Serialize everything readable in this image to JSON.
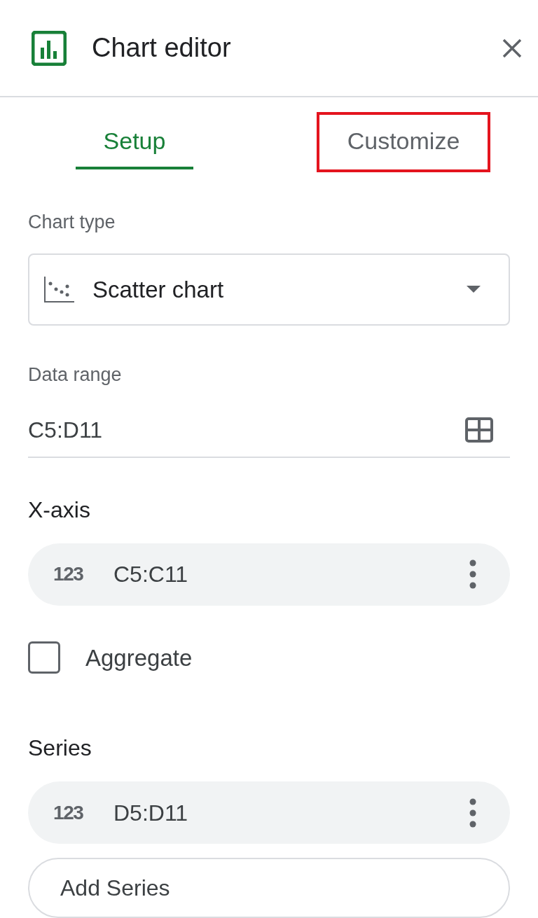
{
  "header": {
    "title": "Chart editor"
  },
  "tabs": [
    {
      "label": "Setup",
      "selected": true,
      "highlighted": false
    },
    {
      "label": "Customize",
      "selected": false,
      "highlighted": true
    }
  ],
  "chart_type": {
    "label": "Chart type",
    "value": "Scatter chart"
  },
  "data_range": {
    "label": "Data range",
    "value": "C5:D11"
  },
  "x_axis": {
    "heading": "X-axis",
    "type_icon": "123",
    "range": "C5:C11"
  },
  "aggregate": {
    "label": "Aggregate",
    "checked": false
  },
  "series": {
    "heading": "Series",
    "items": [
      {
        "type_icon": "123",
        "range": "D5:D11"
      }
    ],
    "add_button": "Add Series"
  }
}
